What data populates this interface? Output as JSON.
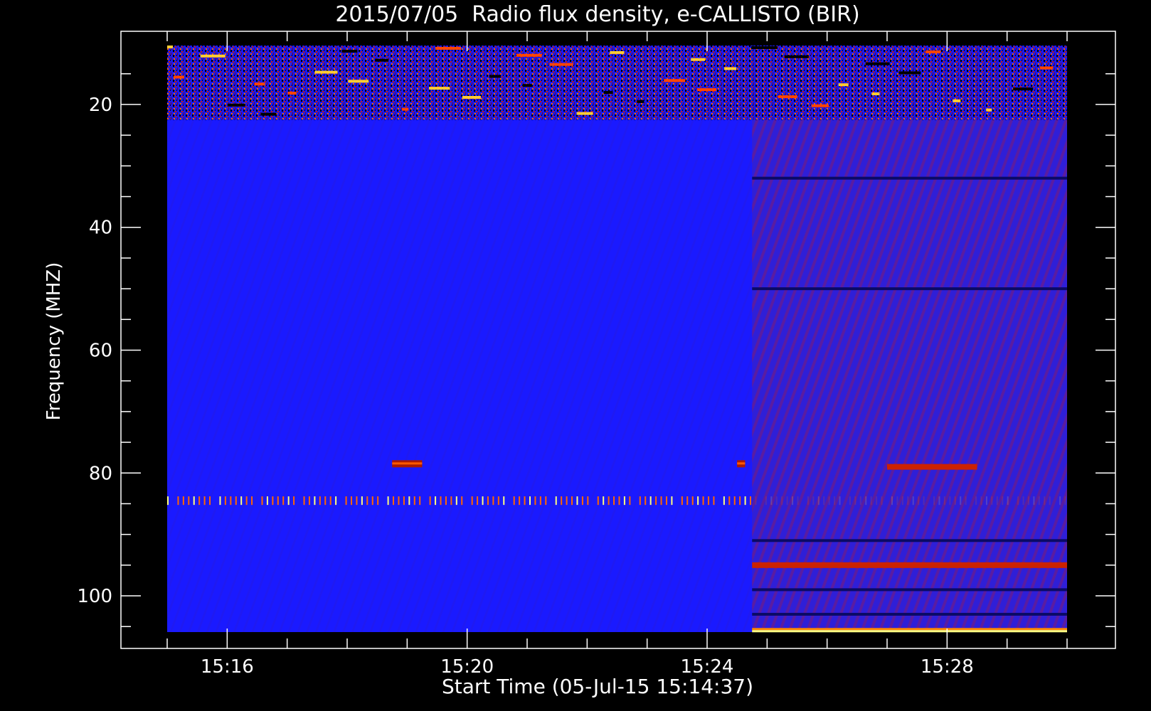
{
  "chart_data": {
    "type": "heatmap",
    "title": "2015/07/05  Radio flux density, e-CALLISTO (BIR)",
    "xlabel": "Start Time (05-Jul-15 15:14:37)",
    "ylabel": "Frequency (MHZ)",
    "x_range": [
      "15:15:00",
      "15:30:00"
    ],
    "y_range_mhz": [
      10.4,
      105.9
    ],
    "y_axis_inverted": true,
    "y_ticks": [
      20,
      40,
      60,
      80,
      100
    ],
    "x_ticks": [
      "15:16",
      "15:20",
      "15:24",
      "15:28"
    ],
    "colormap": [
      "#000000",
      "#0000ff",
      "#8b0000",
      "#ff4500",
      "#ffff80"
    ],
    "background_color": "#1a1aff",
    "features": [
      {
        "name": "interference-band-top",
        "freq_range_mhz": [
          10.4,
          22.5
        ],
        "time_range": [
          "15:15:00",
          "15:30:00"
        ]
      },
      {
        "name": "periodic-spikes",
        "freq_mhz": 84.5,
        "time_range": [
          "15:15:00",
          "15:30:00"
        ]
      },
      {
        "name": "bright-blob",
        "freq_mhz": 78.5,
        "time_range": [
          "15:18:45",
          "15:19:15"
        ]
      },
      {
        "name": "bright-blob",
        "freq_mhz": 78.5,
        "time_range": [
          "15:24:30",
          "15:24:38"
        ]
      },
      {
        "name": "brightened-segment",
        "freq_range_mhz": [
          22.5,
          105.9
        ],
        "time_range": [
          "15:24:45",
          "15:30:00"
        ]
      },
      {
        "name": "band-emission",
        "freq_mhz": 79.0,
        "time_range": [
          "15:27:00",
          "15:28:30"
        ]
      },
      {
        "name": "band-emission",
        "freq_mhz": 95.0,
        "time_range": [
          "15:24:45",
          "15:30:00"
        ]
      },
      {
        "name": "bottom-edge-emission",
        "freq_mhz": 105.7,
        "time_range": [
          "15:24:45",
          "15:30:00"
        ]
      }
    ]
  }
}
